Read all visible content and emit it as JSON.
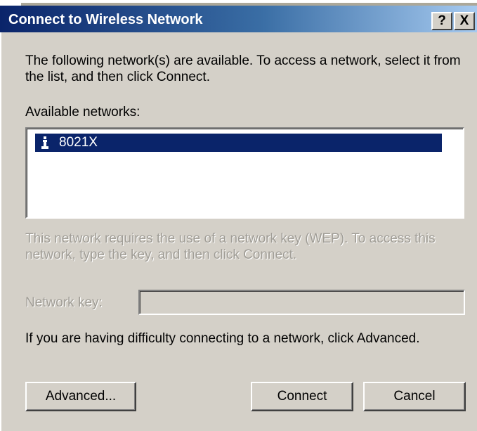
{
  "window": {
    "title": "Connect to Wireless Network",
    "help_label": "?",
    "close_label": "X"
  },
  "intro_text": "The following network(s) are available. To access a network, select it from the list, and then click Connect.",
  "available_label": "Available networks:",
  "networks": [
    {
      "name": "8021X",
      "selected": true,
      "icon": "wireless-network-icon"
    }
  ],
  "wep_text": "This network requires the use of a network key (WEP). To access this network, type the key, and then click Connect.",
  "network_key": {
    "label": "Network key:",
    "value": "",
    "disabled": true
  },
  "difficulty_text": "If you are having difficulty connecting to a network, click Advanced.",
  "buttons": {
    "advanced": "Advanced...",
    "connect": "Connect",
    "cancel": "Cancel"
  },
  "colors": {
    "title_bar": "#0a246a",
    "selection": "#0a246a",
    "dialog_face": "#d4d0c8",
    "disabled_text": "#a09d96"
  }
}
